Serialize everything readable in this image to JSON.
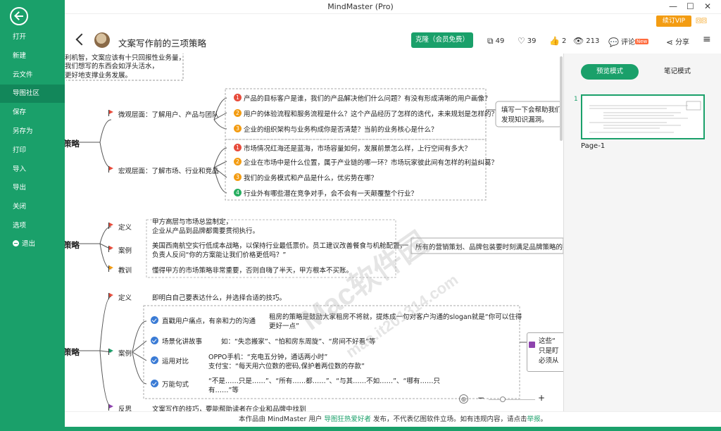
{
  "window": {
    "title": "MindMaster (Pro)",
    "vip_label": "续订VIP",
    "user_label": "回回"
  },
  "colors": {
    "accent": "#1aa06a",
    "vip": "#f39c12",
    "flag_red": "#e74c3c",
    "flag_green": "#1aa06a",
    "flag_orange": "#f39c12",
    "num_red": "#e74c3c",
    "num_orange": "#f39c12",
    "num_green": "#27ae60"
  },
  "sidebar": {
    "back_icon": "arrow-left-circle-icon",
    "items": [
      {
        "label": "打开"
      },
      {
        "label": "新建"
      },
      {
        "label": "云文件"
      },
      {
        "label": "导图社区"
      },
      {
        "label": "保存"
      },
      {
        "label": "另存为"
      },
      {
        "label": "打印"
      },
      {
        "label": "导入"
      },
      {
        "label": "导出"
      },
      {
        "label": "关闭"
      },
      {
        "label": "选项"
      },
      {
        "label": "退出"
      }
    ],
    "active": "导图社区"
  },
  "toolbar": {
    "title": "文案写作前的三项策略",
    "clone_label": "克隆（会员免费）",
    "copies": "49",
    "likes": "39",
    "thumbs": "2",
    "views": "213",
    "comment_label": "评论",
    "new_badge": "New",
    "share_label": "分享"
  },
  "mindmap": {
    "top_note": [
      "利机智，文案应该有十只回报性业务量，",
      "我们想写的东西会如浮头活水，",
      "更好地支撑业务发展。"
    ],
    "branches": [
      {
        "label": "策略"
      },
      {
        "label": "策略"
      },
      {
        "label": "策略"
      }
    ],
    "micro": {
      "label": "微观层面：了解用户、产品与团队",
      "items": [
        "产品的目标客户是谁，我们的产品解决他们什么问题？有没有形成清晰的用户画像？",
        "用户的体验流程和服务流程是什么？这个产品经历了怎样的迭代，未来规划是怎样的？",
        "企业的组织架构与业务构成你是否清楚？当前的业务核心是什么？"
      ],
      "side_note": [
        "填写一下会帮助我们",
        "发现知识漏洞。"
      ]
    },
    "macro": {
      "label": "宏观层面：了解市场、行业和竞品",
      "items": [
        "市场情况红海还是蓝海，市场容量如何，发展前景怎么样，上行空间有多大？",
        "企业在市场中是什么位置，属于产业链的哪一环？市场玩家彼此间有怎样的利益纠葛？",
        "我们的业务模式和产品是什么，优劣势在哪？",
        "行业外有哪些潜在竞争对手，会不会有一天颠覆整个行业？"
      ]
    },
    "b2": {
      "def_label": "定义",
      "def_text": [
        "甲方高层与市场总监制定，",
        "企业从产品到品牌都需要贯彻执行。"
      ],
      "case_label": "案例",
      "case_text": [
        "美国西南航空实行低成本战略，以保持行业最低票价。员工建议改善餐食与机舱配置，",
        "负责人反问“你的方案能让我们价格更低吗？”"
      ],
      "lesson_label": "教训",
      "lesson_text": "懂得甲方的市场策略非常重要，否则自嗨了半天，甲方根本不买账。",
      "side_note": "所有的营销策划、品牌包装要时刻满足品牌策略的要"
    },
    "b3": {
      "def_label": "定义",
      "def_text": "即明白自己要表达什么，并选择合适的技巧。",
      "case_label": "案例",
      "sub": [
        {
          "label": "直戳用户痛点，有亲和力的沟通",
          "text": [
            "租房的策略是鼓励大家租房不将就，提炼成一句对客户沟通的slogan就是“你可以住得",
            "更好一点”"
          ]
        },
        {
          "label": "场景化讲故事",
          "text": [
            "如：“失恋搬家”、“怕和房东周旋”、“房间不好看”等"
          ]
        },
        {
          "label": "运用对比",
          "text": [
            "OPPO手机：“充电五分钟，通话两小时”",
            "支付宝：“每天用六位数的密码,保护着两位数的存款”"
          ]
        },
        {
          "label": "万能句式",
          "text": [
            "“不是……只是……”、“所有……都……”、“与其……不如……”、“哪有……只",
            "有……”等"
          ]
        }
      ],
      "side_note": [
        "这些“",
        "只是盯",
        "必须从"
      ],
      "bottom_label": "反思",
      "bottom_text": "文案写作的技巧，要能帮助读者在企业和品牌中找到"
    }
  },
  "rightpanel": {
    "preview_label": "预览模式",
    "notes_label": "笔记模式",
    "page_num": "1",
    "page_label": "Page-1"
  },
  "zoom": {
    "minus": "−",
    "plus": "+",
    "level": 0.3
  },
  "footer": {
    "prefix": "本作品由 MindMaster 用户 ",
    "user": "导图狂热爱好者",
    "middle": " 发布，不代表亿图软件立场。如有违规内容，请点击",
    "report": "举报",
    "suffix": "。"
  },
  "watermark": {
    "main": "Mac软件园",
    "url": "mac.it201314.com"
  }
}
